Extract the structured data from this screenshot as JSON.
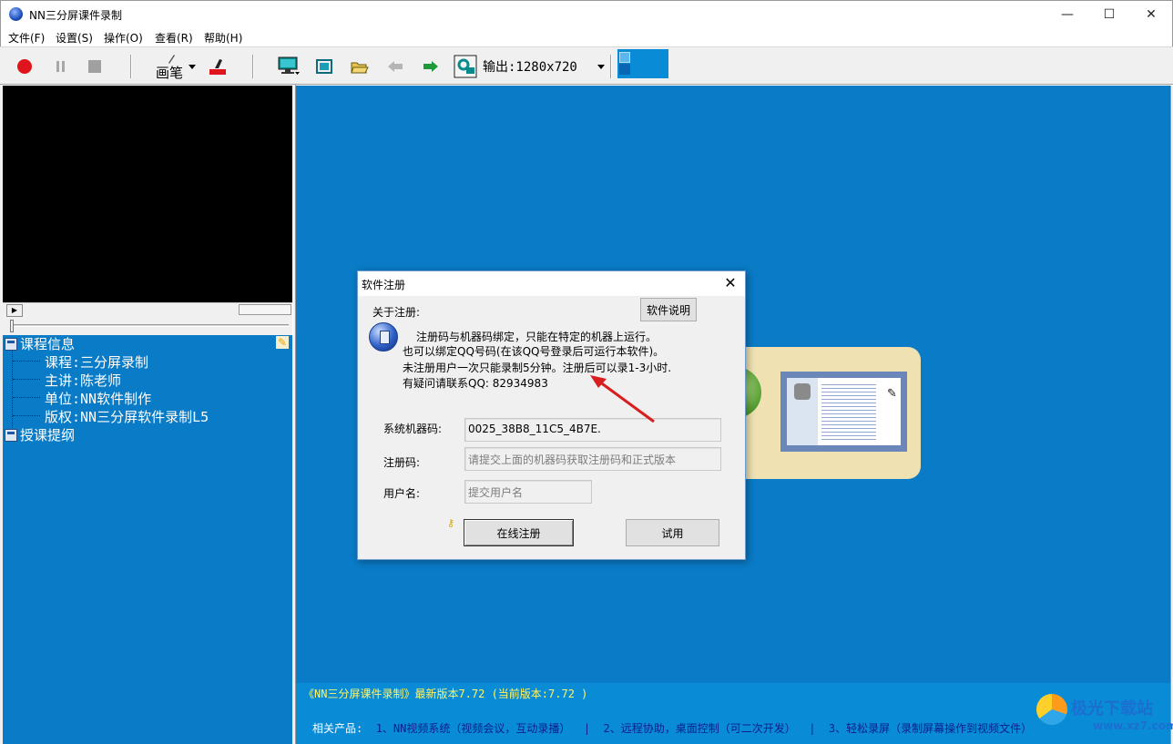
{
  "window": {
    "title": "NN三分屏课件录制",
    "controls": {
      "minimize": "—",
      "maximize": "☐",
      "close": "✕"
    }
  },
  "menu": [
    "文件(F)",
    "设置(S)",
    "操作(O)",
    "查看(R)",
    "帮助(H)"
  ],
  "toolbar": {
    "pen_label": "画笔",
    "output_label": "输出:1280x720",
    "icons": [
      "record-icon",
      "pause-icon",
      "stop-icon",
      "pen-icon",
      "eraser-icon",
      "monitor-icon",
      "fullscreen-icon",
      "open-folder-icon",
      "back-arrow-icon",
      "forward-arrow-icon",
      "settings-icon"
    ]
  },
  "tree": {
    "root1": "课程信息",
    "items": [
      "课程:三分屏录制",
      "主讲:陈老师",
      "单位:NN软件制作",
      "版权:NN三分屏软件录制L5"
    ],
    "root2": "授课提纲"
  },
  "dialog": {
    "title": "软件注册",
    "close": "✕",
    "about_label": "关于注册:",
    "help_button": "软件说明",
    "messages": [
      "注册码与机器码绑定，只能在特定的机器上运行。",
      "也可以绑定QQ号码(在该QQ号登录后可运行本软件)。",
      "未注册用户一次只能录制5分钟。注册后可以录1-3小时.",
      "有疑问请联系QQ: 82934983"
    ],
    "machine_code_label": "系统机器码:",
    "machine_code_value": "0025_38B8_11C5_4B7E.",
    "reg_code_label": "注册码:",
    "reg_code_placeholder": "请提交上面的机器码获取注册码和正式版本",
    "username_label": "用户名:",
    "username_placeholder": "提交用户名",
    "online_register_button": "在线注册",
    "trial_button": "试用"
  },
  "infobar": {
    "line1": "《NN三分屏课件录制》最新版本7.72 (当前版本:7.72   )",
    "related_label": "相关产品:",
    "link1": "1、NN视频系统（视频会议，互动录播）",
    "link2": "2、远程协助，桌面控制（可二次开发）",
    "link3": "3、轻松录屏（录制屏幕操作到视频文件）",
    "sep": "|"
  },
  "watermark": {
    "title": "极光下载站",
    "url": "www.xz7.com"
  },
  "colors": {
    "main_bg": "#0a7bc6",
    "info_yellow": "#fff568",
    "link_blue": "#0a1f8a",
    "record_red": "#e0141c"
  }
}
